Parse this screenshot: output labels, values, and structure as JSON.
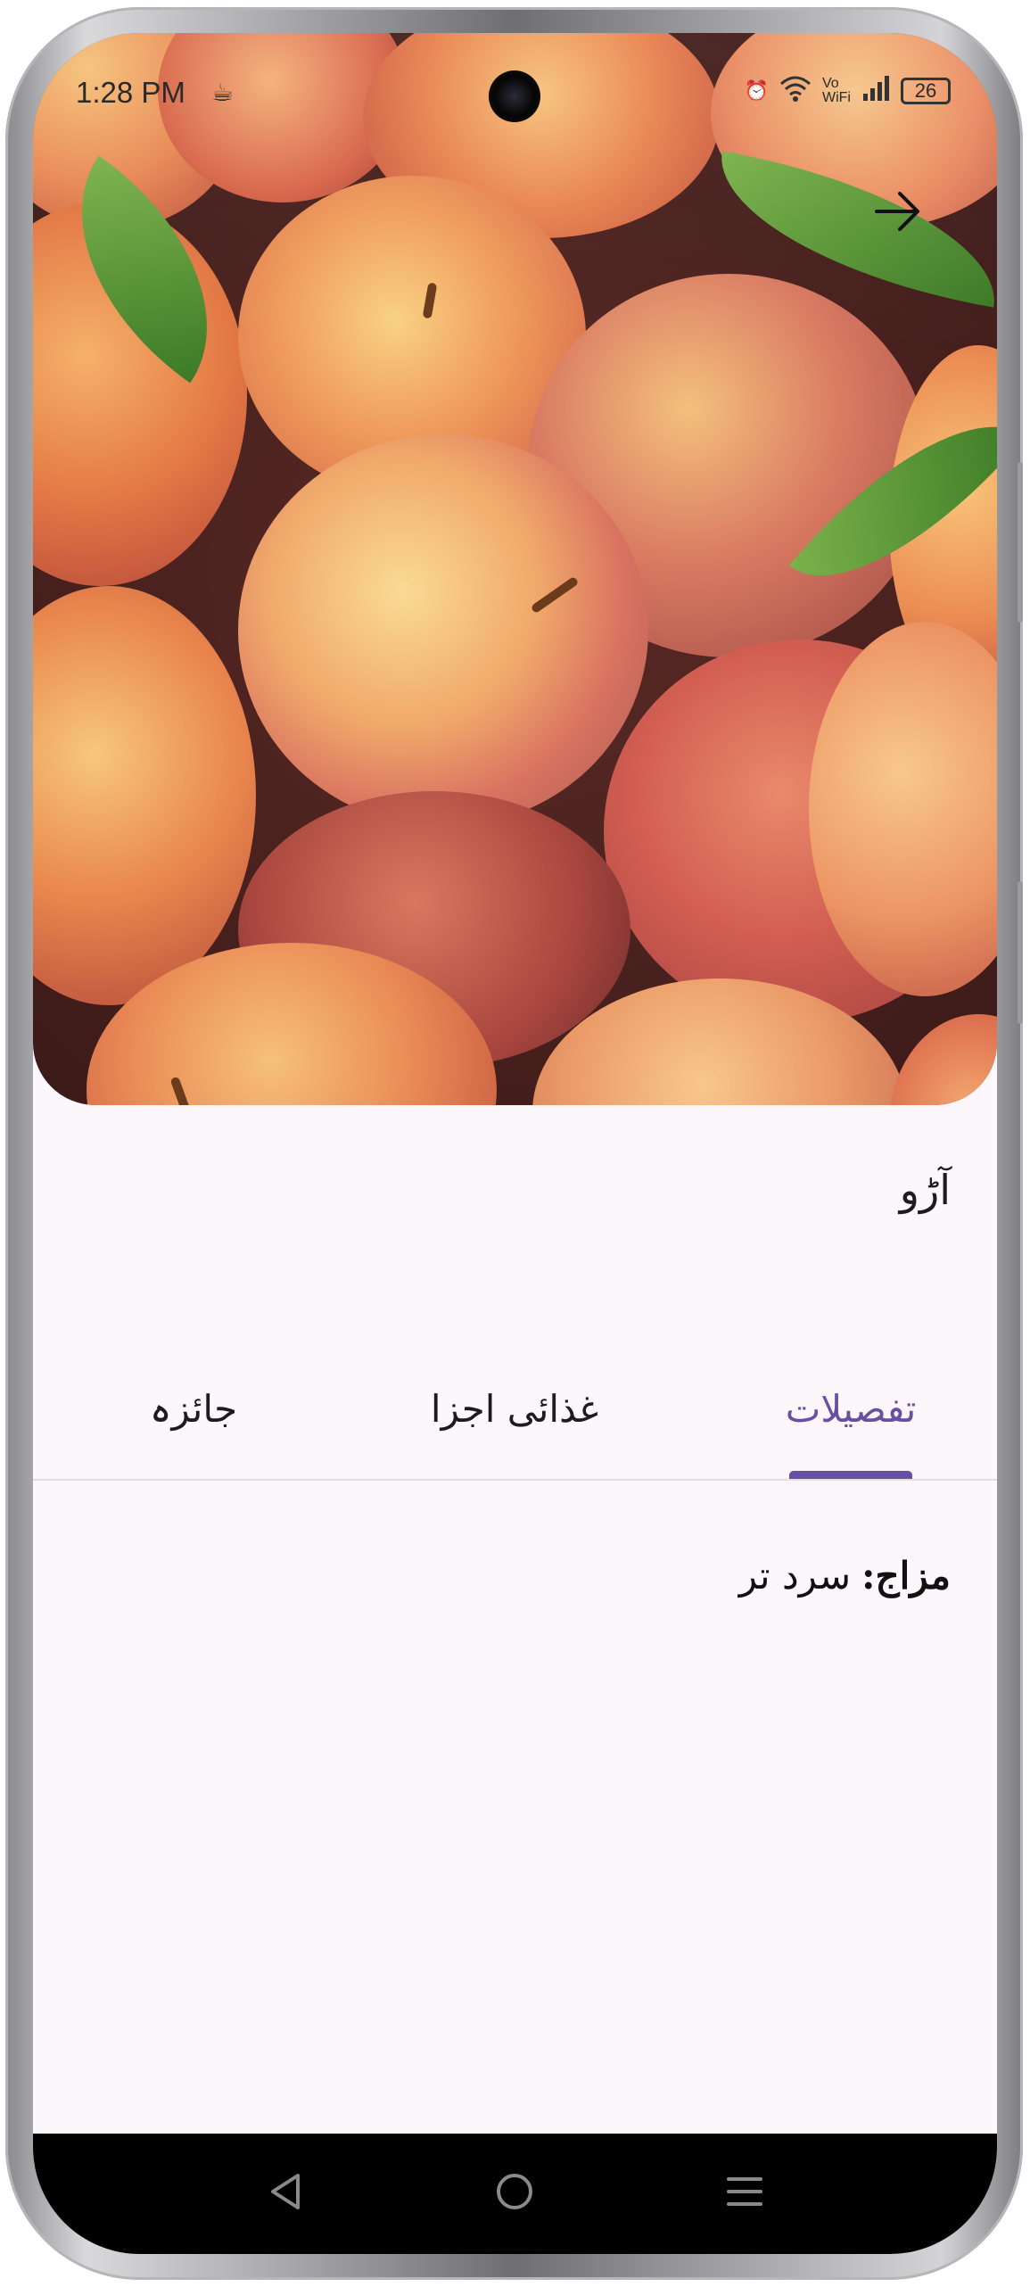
{
  "status_bar": {
    "time": "1:28 PM",
    "network": "Vo WiFi",
    "battery": "26"
  },
  "item": {
    "title": "آڑو"
  },
  "tabs": [
    {
      "label": "تفصیلات",
      "active": true
    },
    {
      "label": "غذائی اجزا",
      "active": false
    },
    {
      "label": "جائزہ",
      "active": false
    }
  ],
  "details": {
    "mizaj_key": "مزاج:",
    "mizaj_value": "سرد تر"
  },
  "colors": {
    "accent": "#6750a4",
    "background": "#fcf7fb"
  },
  "icons": {
    "forward": "arrow-right-icon",
    "back_nav": "triangle-back-icon",
    "home_nav": "circle-home-icon",
    "menu_nav": "lines-menu-icon"
  }
}
